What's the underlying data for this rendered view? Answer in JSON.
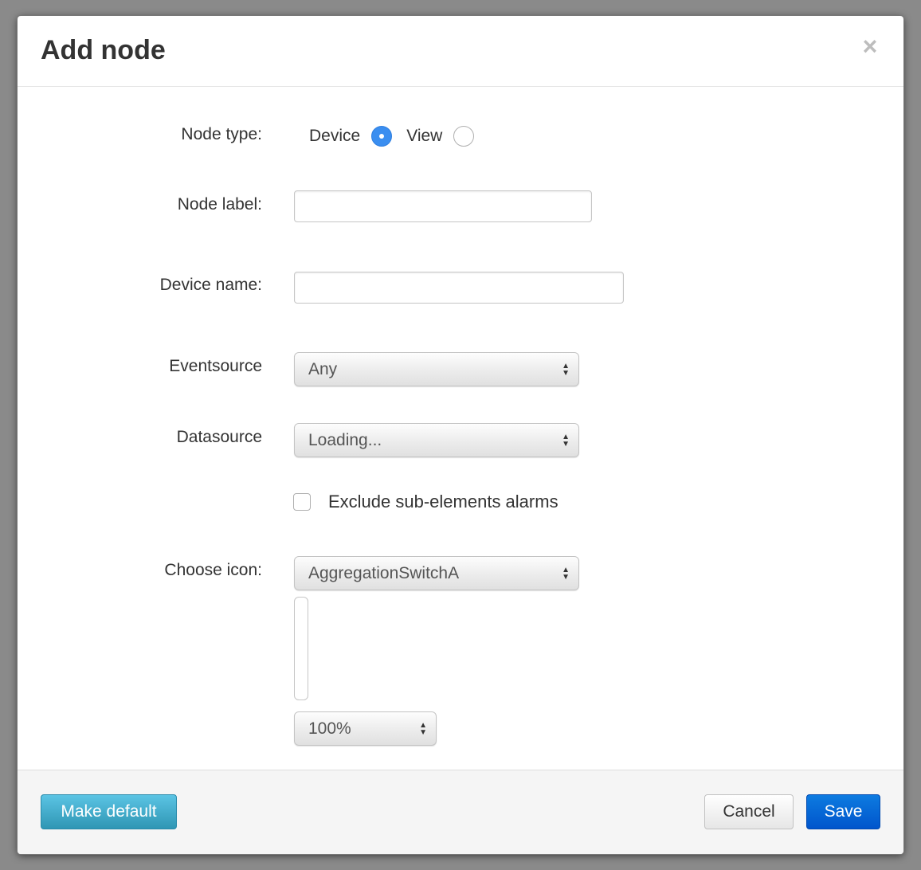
{
  "modal": {
    "title": "Add node",
    "close_symbol": "×"
  },
  "form": {
    "node_type": {
      "label": "Node type:",
      "options": [
        {
          "label": "Device",
          "selected": true
        },
        {
          "label": "View",
          "selected": false
        }
      ]
    },
    "node_label": {
      "label": "Node label:",
      "value": ""
    },
    "device_name": {
      "label": "Device name:",
      "value": ""
    },
    "eventsource": {
      "label": "Eventsource",
      "selected": "Any"
    },
    "datasource": {
      "label": "Datasource",
      "selected": "Loading..."
    },
    "exclude_sub_elements": {
      "label": "Exclude sub-elements alarms",
      "checked": false
    },
    "choose_icon": {
      "label": "Choose icon:",
      "selected": "AggregationSwitchA"
    },
    "icon_scale": {
      "selected": "100%"
    }
  },
  "footer": {
    "make_default_label": "Make default",
    "cancel_label": "Cancel",
    "save_label": "Save"
  },
  "colors": {
    "primary": "#0055cc",
    "info": "#2f96b4",
    "radio_checked": "#3a8ef0"
  }
}
